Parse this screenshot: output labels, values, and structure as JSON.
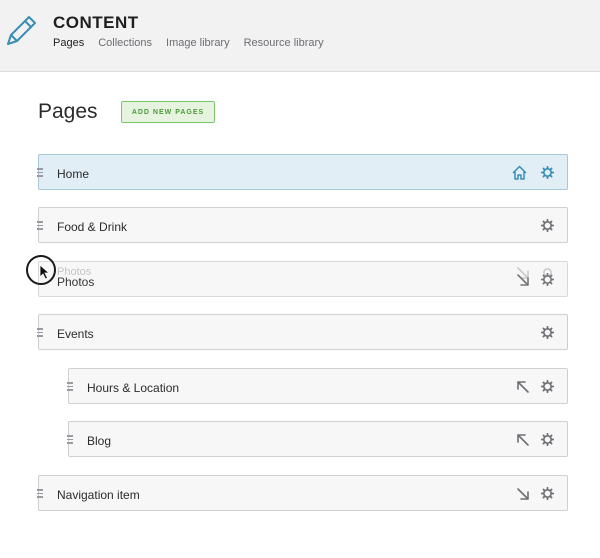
{
  "header": {
    "section_title": "CONTENT",
    "icon": "pencil-icon",
    "nav": [
      "Pages",
      "Collections",
      "Image library",
      "Resource library"
    ],
    "active_nav": "Pages"
  },
  "main": {
    "title": "Pages",
    "add_button_label": "ADD NEW PAGES"
  },
  "rows": [
    {
      "label": "Home",
      "icons": [
        "home-icon",
        "gear-icon"
      ],
      "state": "selected"
    },
    {
      "label": "Food & Drink",
      "icons": [
        "gear-icon"
      ]
    },
    {
      "label": "Photos",
      "icons": [
        "arrow-down-right-icon",
        "gear-icon"
      ],
      "state": "dragging"
    },
    {
      "label": "Events",
      "icons": [
        "gear-icon"
      ]
    },
    {
      "label": "Hours & Location",
      "icons": [
        "arrow-up-left-icon",
        "gear-icon"
      ],
      "nested": true
    },
    {
      "label": "Blog",
      "icons": [
        "arrow-up-left-icon",
        "gear-icon"
      ],
      "nested": true
    },
    {
      "label": "Navigation item",
      "icons": [
        "arrow-down-right-icon",
        "gear-icon"
      ]
    }
  ],
  "drag_ghost_label": "Photos",
  "colors": {
    "selected_row": "#e1eef5",
    "accent_blue": "#3a8db5",
    "add_button_green": "#4a9a3b"
  }
}
